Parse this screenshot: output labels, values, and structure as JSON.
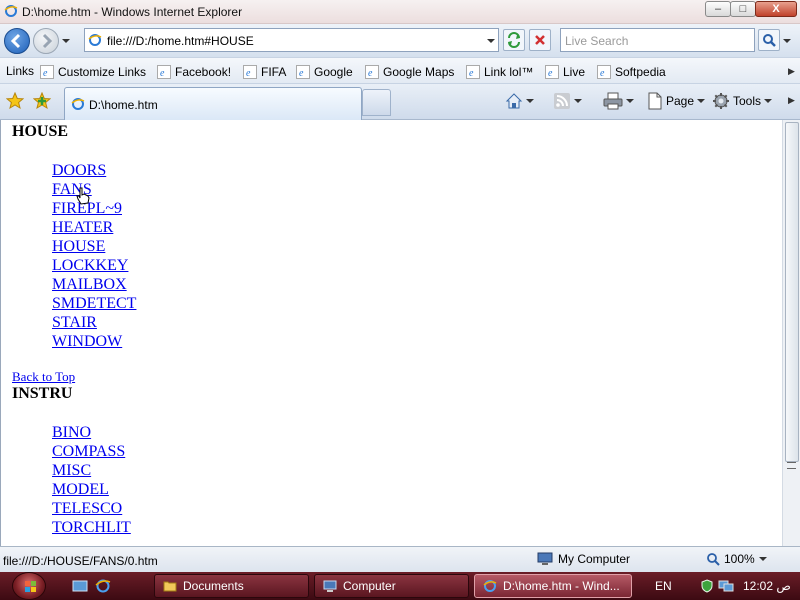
{
  "window": {
    "title": "D:\\home.htm - Windows Internet Explorer",
    "minimize_label": "–",
    "maximize_label": "□",
    "close_label": "X"
  },
  "nav": {
    "address": "file:///D:/home.htm#HOUSE",
    "search_placeholder": "Live Search"
  },
  "links_bar": {
    "label": "Links",
    "items": [
      {
        "label": "Customize Links"
      },
      {
        "label": "Facebook!"
      },
      {
        "label": "FIFA"
      },
      {
        "label": "Google"
      },
      {
        "label": "Google Maps"
      },
      {
        "label": "Link lol™"
      },
      {
        "label": "Live"
      },
      {
        "label": "Softpedia"
      }
    ]
  },
  "tab": {
    "title": "D:\\home.htm"
  },
  "commands": {
    "page": "Page",
    "tools": "Tools"
  },
  "content": {
    "section1": {
      "heading": "HOUSE",
      "links": [
        "DOORS",
        "FANS",
        "FIREPL~9",
        "HEATER",
        "HOUSE",
        "LOCKKEY",
        "MAILBOX",
        "SMDETECT",
        "STAIR",
        "WINDOW"
      ]
    },
    "back_to_top": "Back to Top",
    "section2": {
      "heading": "INSTRU",
      "links": [
        "BINO",
        "COMPASS",
        "MISC",
        "MODEL",
        "TELESCO",
        "TORCHLIT"
      ]
    }
  },
  "status": {
    "text": "file:///D:/HOUSE/FANS/0.htm",
    "zone": "My Computer",
    "zoom": "100%"
  },
  "taskbar": {
    "buttons": [
      {
        "label": "Documents"
      },
      {
        "label": "Computer"
      },
      {
        "label": "D:\\home.htm - Wind..."
      }
    ],
    "lang": "EN",
    "clock": "12:02 ص"
  },
  "colors": {
    "link": "#0000ee",
    "taskbar": "#5a1620"
  }
}
